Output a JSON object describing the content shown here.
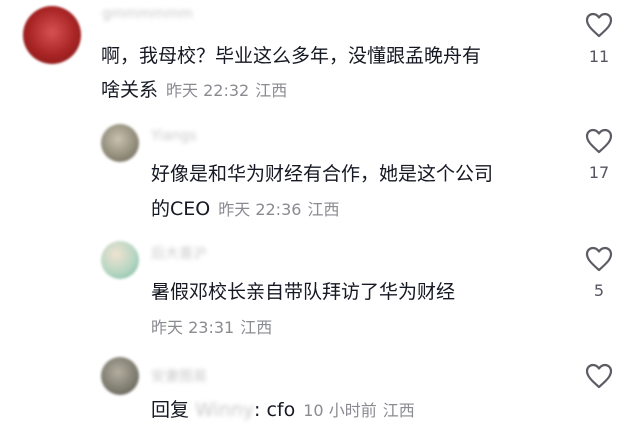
{
  "comments": [
    {
      "username": "gmmmmmm",
      "line1": "啊，我母校？毕业这么多年，没懂跟孟晚舟有",
      "line2": "啥关系",
      "time": "昨天 22:32",
      "location": "江西",
      "likes": "11",
      "avatar_colors": [
        "#8b1a1a",
        "#d44a4a"
      ]
    },
    {
      "username": "Yiangs",
      "line1": "好像是和华为财经有合作，她是这个公司",
      "line2": "的CEO",
      "time": "昨天 22:36",
      "location": "江西",
      "likes": "17",
      "avatar_colors": [
        "#6b6b5a",
        "#b9b0a0"
      ]
    },
    {
      "username": "后大喜沪",
      "line1": "暑假邓校长亲自带队拜访了华为财经",
      "time": "昨天 23:31",
      "location": "江西",
      "likes": "5",
      "avatar_colors": [
        "#7bc0a8",
        "#e9d9c9"
      ]
    },
    {
      "username": "安妻图易",
      "reply_prefix": "回复",
      "reply_to": "Winny",
      "reply_text": ": cfo",
      "time": "10 小时前",
      "location": "江西",
      "likes": "",
      "avatar_colors": [
        "#5a5a55",
        "#a8a498"
      ]
    }
  ],
  "icons": {
    "like": "heart-outline-icon"
  }
}
